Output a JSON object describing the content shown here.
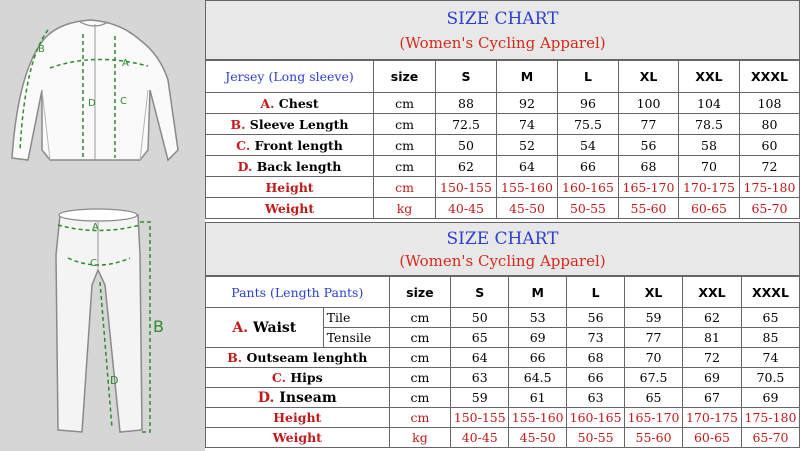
{
  "jersey": {
    "title": "SIZE CHART",
    "subtitle": "(Women's Cycling Apparel)",
    "category_label": "Jersey  (Long sleeve)",
    "size_label": "size",
    "sizes": [
      "S",
      "M",
      "L",
      "XL",
      "XXL",
      "XXXL"
    ],
    "rows": [
      {
        "letter": "A.",
        "name": "Chest",
        "unit": "cm",
        "values": [
          "88",
          "92",
          "96",
          "100",
          "104",
          "108"
        ]
      },
      {
        "letter": "B.",
        "name": "Sleeve Length",
        "unit": "cm",
        "values": [
          "72.5",
          "74",
          "75.5",
          "77",
          "78.5",
          "80"
        ]
      },
      {
        "letter": "C.",
        "name": "Front length",
        "unit": "cm",
        "values": [
          "50",
          "52",
          "54",
          "56",
          "58",
          "60"
        ]
      },
      {
        "letter": "D.",
        "name": "Back length",
        "unit": "cm",
        "values": [
          "62",
          "64",
          "66",
          "68",
          "70",
          "72"
        ]
      }
    ],
    "height": {
      "name": "Height",
      "unit": "cm",
      "values": [
        "150-155",
        "155-160",
        "160-165",
        "165-170",
        "170-175",
        "175-180"
      ]
    },
    "weight": {
      "name": "Weight",
      "unit": "kg",
      "values": [
        "40-45",
        "45-50",
        "50-55",
        "55-60",
        "60-65",
        "65-70"
      ]
    }
  },
  "pants": {
    "title": "SIZE CHART",
    "subtitle": "(Women's Cycling Apparel)",
    "category_label": "Pants  (Length Pants)",
    "size_label": "size",
    "sizes": [
      "S",
      "M",
      "L",
      "XL",
      "XXL",
      "XXXL"
    ],
    "waist": {
      "letter": "A.",
      "name": "Waist",
      "tile": {
        "name": "Tile",
        "unit": "cm",
        "values": [
          "50",
          "53",
          "56",
          "59",
          "62",
          "65"
        ]
      },
      "tensile": {
        "name": "Tensile",
        "unit": "cm",
        "values": [
          "65",
          "69",
          "73",
          "77",
          "81",
          "85"
        ]
      }
    },
    "rows": [
      {
        "letter": "B.",
        "name": "Outseam lenghth",
        "unit": "cm",
        "values": [
          "64",
          "66",
          "68",
          "70",
          "72",
          "74"
        ]
      },
      {
        "letter": "C.",
        "name": "Hips",
        "unit": "cm",
        "values": [
          "63",
          "64.5",
          "66",
          "67.5",
          "69",
          "70.5"
        ]
      },
      {
        "letter": "D.",
        "name": "Inseam",
        "unit": "cm",
        "values": [
          "59",
          "61",
          "63",
          "65",
          "67",
          "69"
        ]
      }
    ],
    "height": {
      "name": "Height",
      "unit": "cm",
      "values": [
        "150-155",
        "155-160",
        "160-165",
        "165-170",
        "170-175",
        "175-180"
      ]
    },
    "weight": {
      "name": "Weight",
      "unit": "kg",
      "values": [
        "40-45",
        "45-50",
        "50-55",
        "55-60",
        "60-65",
        "65-70"
      ]
    }
  },
  "diagram_labels": {
    "jersey": [
      "A",
      "B",
      "C",
      "D"
    ],
    "pants": [
      "A",
      "B",
      "C",
      "D"
    ]
  },
  "colors": {
    "measure_line": "#2e8b2e",
    "label_letter": "#2e8b2e",
    "title_blue": "#2a3fd0",
    "accent_red": "#c21a1a"
  }
}
